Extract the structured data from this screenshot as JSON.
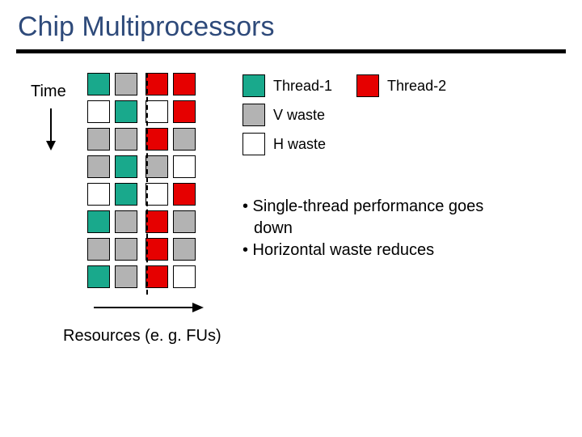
{
  "title": "Chip Multiprocessors",
  "axes": {
    "time_label": "Time",
    "resources_label": "Resources (e. g. FUs)"
  },
  "legend": {
    "thread1": "Thread-1",
    "thread2": "Thread-2",
    "vwaste": "V waste",
    "hwaste": "H waste"
  },
  "colors": {
    "thread1": "#19a98c",
    "thread2": "#e60000",
    "vwaste": "#b3b3b3",
    "hwaste": "#ffffff"
  },
  "bullets": {
    "b1": "• Single-thread performance goes",
    "b1b": "down",
    "b2": "• Horizontal waste reduces"
  },
  "chart_data": {
    "type": "table",
    "title": "Chip Multiprocessors execution grid",
    "xlabel": "Resources (e. g. FUs)",
    "ylabel": "Time",
    "columns_per_processor": 2,
    "processors": 2,
    "rows": 8,
    "cell_legend": {
      "T1": "Thread-1",
      "T2": "Thread-2",
      "V": "V waste",
      "H": "H waste"
    },
    "grid": [
      [
        "T1",
        "V",
        "T2",
        "T2"
      ],
      [
        "H",
        "T1",
        "H",
        "T2"
      ],
      [
        "V",
        "V",
        "T2",
        "V"
      ],
      [
        "V",
        "T1",
        "V",
        "H"
      ],
      [
        "H",
        "T1",
        "H",
        "T2"
      ],
      [
        "T1",
        "V",
        "T2",
        "V"
      ],
      [
        "V",
        "V",
        "T2",
        "V"
      ],
      [
        "T1",
        "V",
        "T2",
        "H"
      ]
    ]
  }
}
